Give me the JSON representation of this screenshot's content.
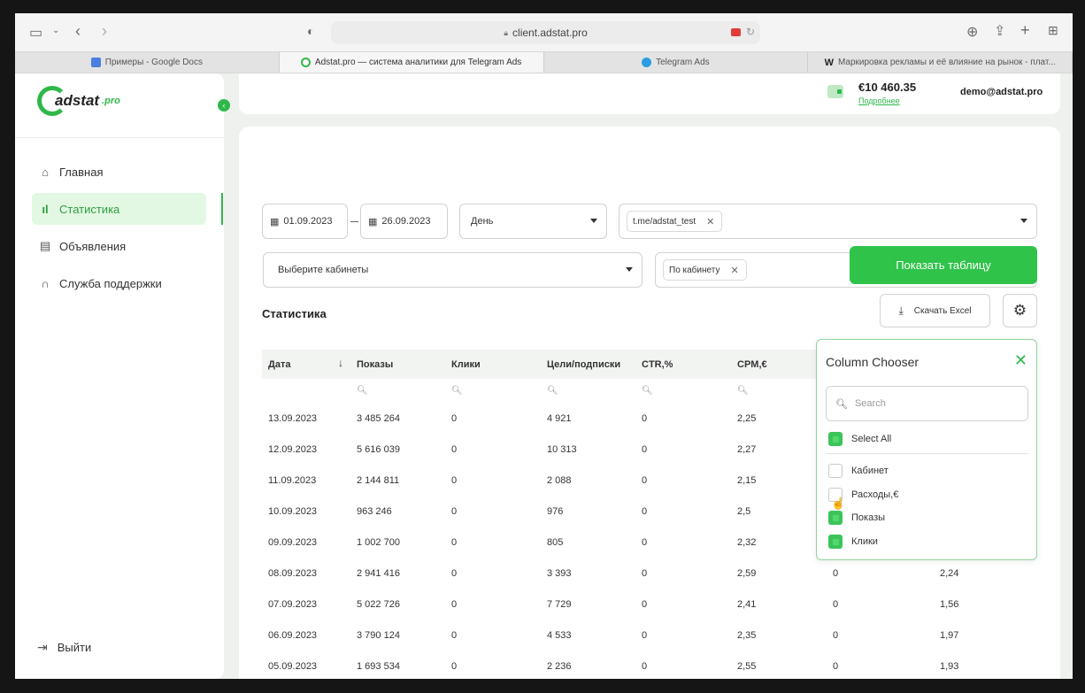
{
  "browser": {
    "url": "client.adstat.pro",
    "tabs": [
      {
        "label": "Примеры - Google Docs",
        "color": "#4a7fe0"
      },
      {
        "label": "Adstat.pro — система аналитики для Telegram Ads",
        "color": "#2fb84a"
      },
      {
        "label": "Telegram Ads",
        "color": "#2a9de0"
      },
      {
        "label": "Маркировка рекламы и её влияние на рынок - плат...",
        "color": "#222222"
      }
    ]
  },
  "sidebar": {
    "logo": "adstat",
    "logo_suffix": ".pro",
    "items": [
      {
        "label": "Главная",
        "icon": "home-icon"
      },
      {
        "label": "Статистика",
        "icon": "bar-chart-icon"
      },
      {
        "label": "Объявления",
        "icon": "document-icon"
      },
      {
        "label": "Служба поддержки",
        "icon": "headset-icon"
      }
    ],
    "logout": "Выйти"
  },
  "header": {
    "balance": "€10 460.35",
    "details_link": "Подробнее",
    "email": "demo@adstat.pro"
  },
  "filters": {
    "date_from": "01.09.2023",
    "date_to": "26.09.2023",
    "period": "День",
    "channel_chip": "t.me/adstat_test",
    "cabinets_placeholder": "Выберите кабинеты",
    "grouping_chip": "По кабинету",
    "show_button": "Показать таблицу"
  },
  "stats": {
    "title": "Статистика",
    "excel_button": "Скачать Excel",
    "columns": [
      "Дата",
      "Показы",
      "Клики",
      "Цели/подписки",
      "CTR,%",
      "CPM,€"
    ],
    "rows": [
      [
        "13.09.2023",
        "3 485 264",
        "0",
        "4 921",
        "0",
        "2,25",
        "",
        ""
      ],
      [
        "12.09.2023",
        "5 616 039",
        "0",
        "10 313",
        "0",
        "2,27",
        "",
        ""
      ],
      [
        "11.09.2023",
        "2 144 811",
        "0",
        "2 088",
        "0",
        "2,15",
        "",
        ""
      ],
      [
        "10.09.2023",
        "963 246",
        "0",
        "976",
        "0",
        "2,5",
        "",
        ""
      ],
      [
        "09.09.2023",
        "1 002 700",
        "0",
        "805",
        "0",
        "2,32",
        "",
        ""
      ],
      [
        "08.09.2023",
        "2 941 416",
        "0",
        "3 393",
        "0",
        "2,59",
        "0",
        "2,24"
      ],
      [
        "07.09.2023",
        "5 022 726",
        "0",
        "7 729",
        "0",
        "2,41",
        "0",
        "1,56"
      ],
      [
        "06.09.2023",
        "3 790 124",
        "0",
        "4 533",
        "0",
        "2,35",
        "0",
        "1,97"
      ],
      [
        "05.09.2023",
        "1 693 534",
        "0",
        "2 236",
        "0",
        "2,55",
        "0",
        "1,93"
      ]
    ]
  },
  "column_chooser": {
    "title": "Column Chooser",
    "search_placeholder": "Search",
    "select_all": "Select All",
    "items": [
      {
        "label": "Кабинет",
        "checked": false
      },
      {
        "label": "Расходы,€",
        "checked": false
      },
      {
        "label": "Показы",
        "checked": true
      },
      {
        "label": "Клики",
        "checked": true
      }
    ]
  },
  "colors": {
    "accent": "#2fc34a",
    "accent_light": "#e3f8e2"
  }
}
